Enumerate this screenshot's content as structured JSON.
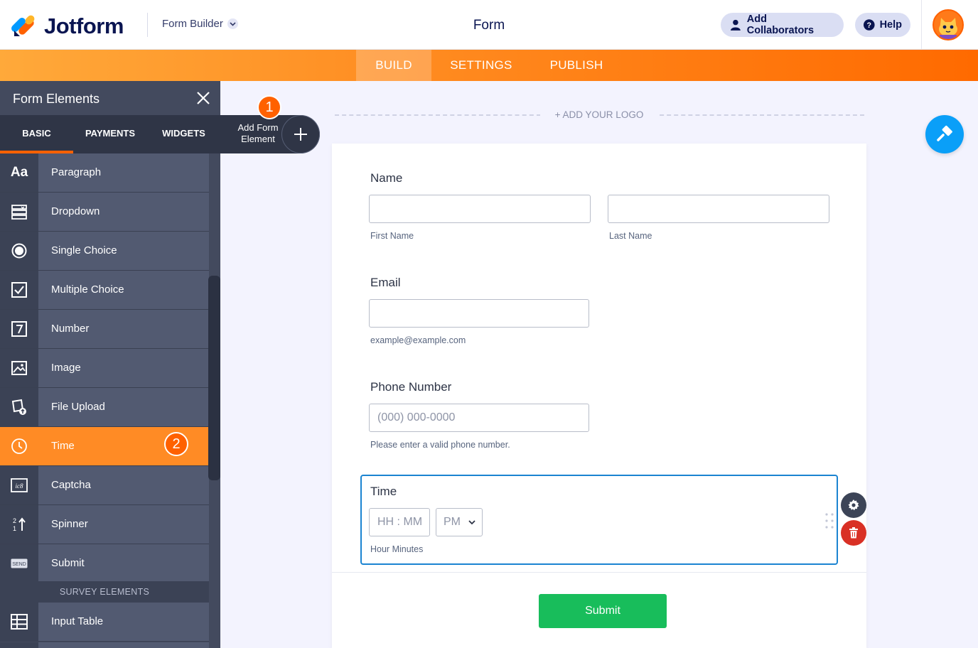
{
  "header": {
    "brand": "Jotform",
    "builder_label": "Form Builder",
    "title": "Form",
    "add_collaborators": "Add Collaborators",
    "help": "Help"
  },
  "nav": {
    "tabs": [
      {
        "label": "BUILD",
        "active": true
      },
      {
        "label": "SETTINGS",
        "active": false
      },
      {
        "label": "PUBLISH",
        "active": false
      }
    ]
  },
  "panel": {
    "title": "Form Elements",
    "tabs": [
      {
        "label": "BASIC",
        "active": true
      },
      {
        "label": "PAYMENTS",
        "active": false
      },
      {
        "label": "WIDGETS",
        "active": false
      }
    ],
    "items": [
      {
        "label": "Paragraph",
        "icon": "paragraph-icon"
      },
      {
        "label": "Dropdown",
        "icon": "dropdown-icon"
      },
      {
        "label": "Single Choice",
        "icon": "radio-icon"
      },
      {
        "label": "Multiple Choice",
        "icon": "checkbox-icon"
      },
      {
        "label": "Number",
        "icon": "number-icon"
      },
      {
        "label": "Image",
        "icon": "image-icon"
      },
      {
        "label": "File Upload",
        "icon": "file-upload-icon"
      },
      {
        "label": "Time",
        "icon": "clock-icon",
        "selected": true
      },
      {
        "label": "Captcha",
        "icon": "captcha-icon"
      },
      {
        "label": "Spinner",
        "icon": "spinner-icon"
      },
      {
        "label": "Submit",
        "icon": "submit-icon"
      }
    ],
    "survey_header": "SURVEY ELEMENTS",
    "survey_items": [
      {
        "label": "Input Table",
        "icon": "table-icon"
      }
    ]
  },
  "badges": {
    "step1": "1",
    "step2": "2"
  },
  "add_element": {
    "label": "Add Form Element"
  },
  "canvas": {
    "add_logo": "+ ADD YOUR LOGO"
  },
  "form": {
    "name": {
      "label": "Name",
      "first_sublabel": "First Name",
      "last_sublabel": "Last Name"
    },
    "email": {
      "label": "Email",
      "sublabel": "example@example.com"
    },
    "phone": {
      "label": "Phone Number",
      "placeholder": "(000) 000-0000",
      "sublabel": "Please enter a valid phone number."
    },
    "time": {
      "label": "Time",
      "placeholder": "HH : MM",
      "ampm": "PM",
      "sublabel": "Hour Minutes"
    },
    "submit": "Submit"
  },
  "colors": {
    "accent_orange": "#ff6100",
    "selected_item": "#ff8b25",
    "submit_green": "#18bd5b",
    "focus_blue": "#1b84d1",
    "delete_red": "#d93025"
  }
}
